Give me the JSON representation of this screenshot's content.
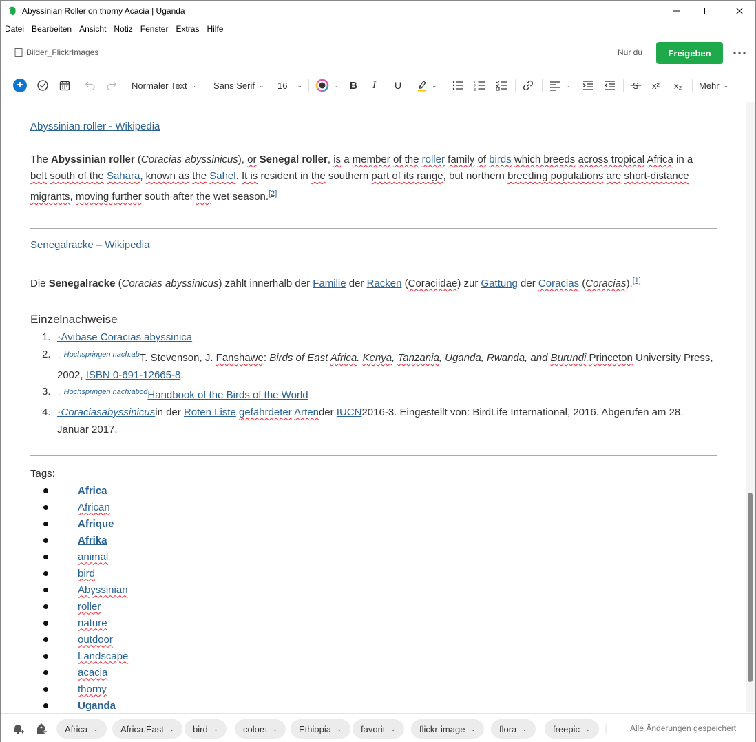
{
  "window": {
    "title": "Abyssinian Roller on thorny Acacia | Uganda"
  },
  "menu": [
    "Datei",
    "Bearbeiten",
    "Ansicht",
    "Notiz",
    "Fenster",
    "Extras",
    "Hilfe"
  ],
  "header": {
    "notebook": "Bilder_FlickrImages",
    "only_you": "Nur du",
    "share": "Freigeben"
  },
  "toolbar": {
    "style": "Normaler Text",
    "font": "Sans Serif",
    "size": "16",
    "more": "Mehr"
  },
  "content": {
    "wiki_en_link": "Abyssinian roller - Wikipedia",
    "wiki_en_text": {
      "t1": "The ",
      "b1": "Abyssinian roller",
      "t2": " (",
      "i1": "Coracias abyssinicus",
      "t3": "), ",
      "or": "or",
      "t4": " ",
      "b2": "Senegal roller",
      "t5": ", ",
      "is": "is",
      "t6": " a ",
      "member": "member",
      "t7": " ",
      "of_the": "of the",
      "t8": " ",
      "roller": "roller",
      "t9": " ",
      "family": "family",
      "t10": " ",
      "of": "of",
      "t11": " ",
      "birds": "birds",
      "t12": " ",
      "which_breeds": "which breeds",
      "t13": " ",
      "across_tropical": "across tropical",
      "t14": " ",
      "africa": "Africa",
      "t15": " in a ",
      "belt": "belt",
      "t16": " ",
      "south_of_the": "south of the",
      "t17": " ",
      "sahara": "Sahara",
      "t18": ", ",
      "known_as": "known as",
      "t19": " ",
      "the": "the",
      "t20": " ",
      "sahel": "Sahel",
      "t21": ". ",
      "it_is": "It is",
      "t22": " resident in ",
      "the2": "the",
      "t23": " southern ",
      "part_of_its_range": "part of its range",
      "t24": ", but northern ",
      "breeding_populations": "breeding populations",
      "t25": " ",
      "are": "are",
      "t26": " ",
      "short_distance": "short-distance",
      "t27": " ",
      "migrants": "migrants",
      "t28": ", ",
      "moving_further": "moving further",
      "t29": " south after ",
      "the3": "the",
      "t30": " wet season.",
      "ref": "[2]"
    },
    "wiki_de_link": "Senegalracke – Wikipedia",
    "wiki_de_text": {
      "t1": "Die ",
      "b1": "Senegalracke",
      "t2": " (",
      "i1": "Coracias abyssinicus",
      "t3": ") zählt innerhalb der ",
      "familie": "Familie",
      "t4": " der ",
      "racken": "Racken",
      "t5": " (",
      "coraciidae": "Coraciidae",
      "t6": ") zur ",
      "gattung": "Gattung",
      "t7": " der ",
      "coracias": "Coracias",
      "t8": " (",
      "coracias_i": "Coracias",
      "t9": ").",
      "ref": "[1]"
    },
    "refs_heading": "Einzelnachweise",
    "refs": {
      "r1": {
        "num": "1.",
        "arrow": "↑",
        "link": "Avibase Coracias abyssinica"
      },
      "r2": {
        "num": "2.",
        "arrow": "↑",
        "jump": "Hochspringen nach:",
        "a": "a",
        "b": "b",
        "t1": "T. Stevenson, J. ",
        "fanshawe": "Fanshawe",
        "t2": ": ",
        "title1": "Birds of East ",
        "africa": "Africa",
        "title2": ". ",
        "kenya": "Kenya",
        "title3": ", ",
        "tanzania": "Tanzania",
        "title4": ", Uganda, Rwanda, and ",
        "burundi": "Burundi",
        "title5": ".",
        "princeton": "Princeton",
        "t3": " University Press, 2002, ",
        "isbn": "ISBN 0-691-12665-8",
        "t4": "."
      },
      "r3": {
        "num": "3.",
        "arrow": "↑",
        "jump": "Hochspringen nach:",
        "a": "a",
        "b": "b",
        "c": "c",
        "d": "d",
        "link": "Handbook of the Birds of the World"
      },
      "r4": {
        "num": "4.",
        "arrow": "↑",
        "species": "Coraciasabyssinicus",
        "t1": "in der ",
        "roten_liste": "Roten Liste",
        "t2": " ",
        "gefaehrdeter": "gefährdeter",
        "t3": " ",
        "arten": "Arten",
        "t4": "der ",
        "iucn": "IUCN",
        "t5": "2016-3. Eingestellt von: BirdLife International, 2016. Abgerufen am 28. Januar 2017."
      }
    },
    "tags_label": "Tags:",
    "tags": [
      {
        "label": "Africa",
        "bold": true
      },
      {
        "label": "African",
        "bold": false
      },
      {
        "label": "Afrique",
        "bold": true
      },
      {
        "label": "Afrika",
        "bold": true
      },
      {
        "label": "animal",
        "bold": false
      },
      {
        "label": "bird",
        "bold": false
      },
      {
        "label": "Abyssinian",
        "bold": false
      },
      {
        "label": "roller",
        "bold": false
      },
      {
        "label": "nature",
        "bold": false
      },
      {
        "label": "outdoor",
        "bold": false
      },
      {
        "label": "Landscape",
        "bold": false
      },
      {
        "label": "acacia",
        "bold": false
      },
      {
        "label": "thorny",
        "bold": false
      },
      {
        "label": "Uganda",
        "bold": true
      }
    ]
  },
  "footer": {
    "chips": [
      "Africa",
      "Africa.East",
      "bird",
      "colors",
      "Ethiopia",
      "favorit",
      "flickr-image",
      "flora",
      "freepic"
    ],
    "saved": "Alle Änderungen gespeichert"
  },
  "colors": {
    "accent": "#1ea94b",
    "link": "#2a6294",
    "insert": "#0b77d3",
    "spell": "#e22233"
  }
}
